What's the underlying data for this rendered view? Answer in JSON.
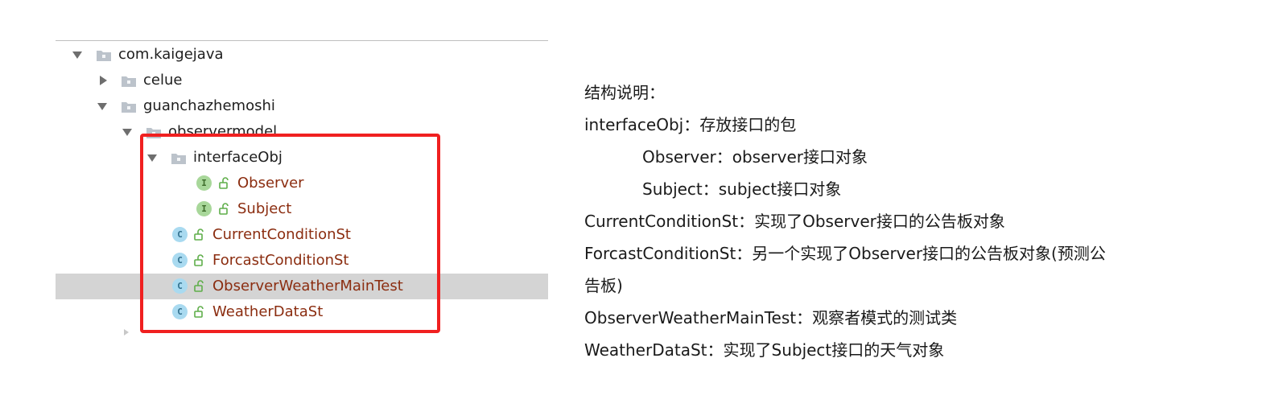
{
  "tree": {
    "rows": [
      {
        "label": "com.kaigejava",
        "kind": "package",
        "expanded": true
      },
      {
        "label": "celue",
        "kind": "package",
        "expanded": false
      },
      {
        "label": "guanchazhemoshi",
        "kind": "package",
        "expanded": true
      },
      {
        "label": "observermodel",
        "kind": "package",
        "expanded": true
      },
      {
        "label": "interfaceObj",
        "kind": "package",
        "expanded": true
      },
      {
        "label": "Observer",
        "kind": "interface",
        "badge": "I"
      },
      {
        "label": "Subject",
        "kind": "interface",
        "badge": "I"
      },
      {
        "label": "CurrentConditionSt",
        "kind": "class",
        "badge": "C"
      },
      {
        "label": "ForcastConditionSt",
        "kind": "class",
        "badge": "C"
      },
      {
        "label": "ObserverWeatherMainTest",
        "kind": "class",
        "badge": "C",
        "selected": true
      },
      {
        "label": "WeatherDataSt",
        "kind": "class",
        "badge": "C"
      }
    ]
  },
  "description": {
    "heading": "结构说明：",
    "lines": [
      "interfaceObj：存放接口的包",
      "Observer：observer接口对象",
      "Subject：subject接口对象",
      "CurrentConditionSt：实现了Observer接口的公告板对象",
      "ForcastConditionSt：另一个实现了Observer接口的公告板对象(预测公",
      "告板)",
      "ObserverWeatherMainTest：观察者模式的测试类",
      "WeatherDataSt：实现了Subject接口的天气对象"
    ]
  },
  "colors": {
    "highlight_box": "#f02020",
    "selected_row": "#d4d4d4",
    "class_name": "#8b2d10",
    "interface_badge": "#a8d79a",
    "class_badge": "#a9daf0"
  }
}
